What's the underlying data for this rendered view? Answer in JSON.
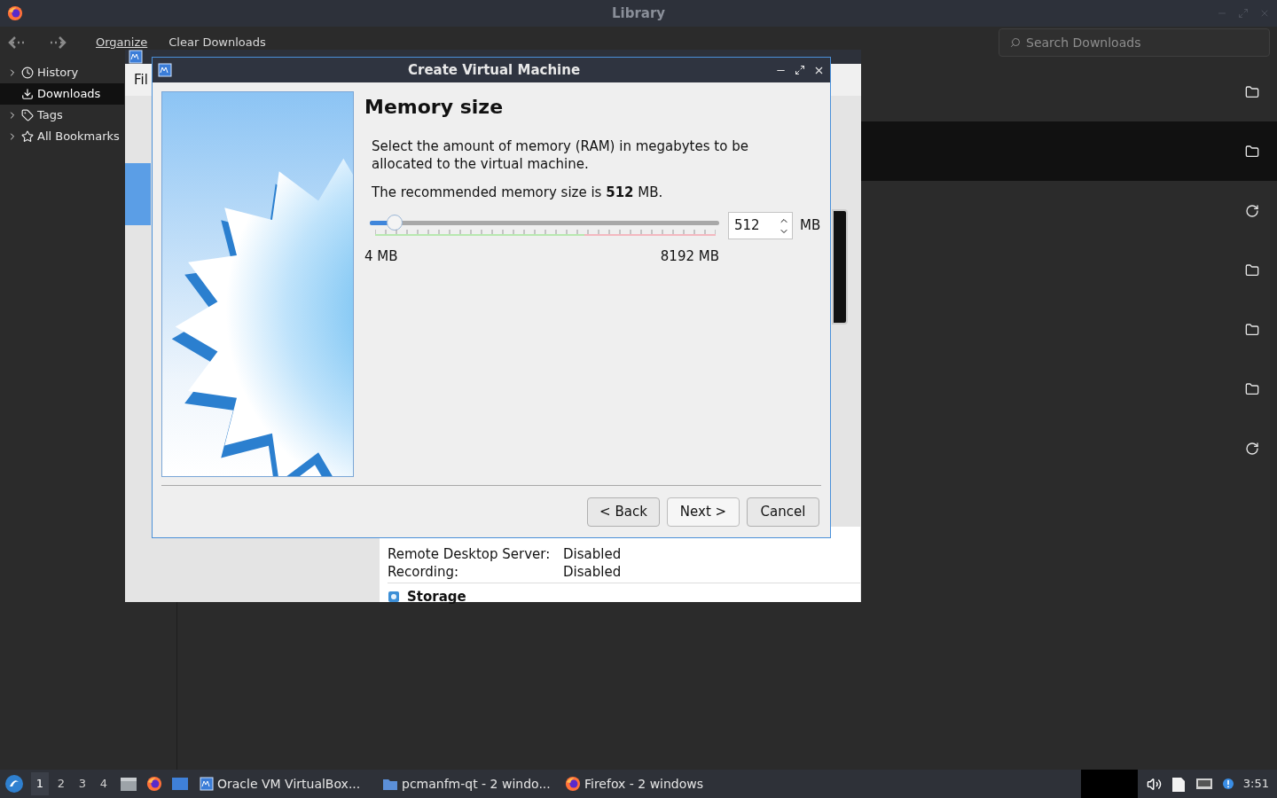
{
  "library": {
    "title": "Library",
    "toolbar": [
      "Organize",
      "Clear Downloads"
    ],
    "search": {
      "placeholder": "Search Downloads"
    },
    "sidebar": [
      {
        "label": "History",
        "expandable": true,
        "selected": false
      },
      {
        "label": "Downloads",
        "expandable": false,
        "selected": true
      },
      {
        "label": "Tags",
        "expandable": true,
        "selected": false
      },
      {
        "label": "All Bookmarks",
        "expandable": true,
        "selected": false
      }
    ],
    "downloads": [
      {
        "kind": "folder",
        "selected": false
      },
      {
        "kind": "folder",
        "selected": true
      },
      {
        "kind": "retry",
        "selected": false
      },
      {
        "kind": "folder",
        "selected": false
      },
      {
        "kind": "folder",
        "selected": false
      },
      {
        "kind": "folder",
        "selected": false
      },
      {
        "kind": "retry",
        "selected": false
      }
    ]
  },
  "vbox_manager": {
    "menu": "Fil",
    "details": [
      {
        "label": "Remote Desktop Server:",
        "value": "Disabled"
      },
      {
        "label": "Recording:",
        "value": "Disabled"
      }
    ],
    "section": "Storage"
  },
  "dialog": {
    "title": "Create Virtual Machine",
    "heading": "Memory size",
    "description": "Select the amount of memory (RAM) in megabytes to be allocated to the virtual machine.",
    "recommendation": "The recommended memory size is **512** MB.",
    "slider": {
      "level": 0.07,
      "min_label": "4 MB",
      "max_label": "8192 MB"
    },
    "value": "512",
    "unit": "MB",
    "buttons": [
      {
        "label": "< Back",
        "kind": "back"
      },
      {
        "label": "Next >",
        "kind": "next"
      },
      {
        "label": "Cancel",
        "kind": "cancel"
      }
    ]
  },
  "taskbar": {
    "workspaces": [
      {
        "label": "1",
        "selected": true
      },
      {
        "label": "2",
        "selected": false
      },
      {
        "label": "3",
        "selected": false
      },
      {
        "label": "4",
        "selected": false
      }
    ],
    "tasks": [
      {
        "label": "Oracle VM VirtualBox...",
        "kind": "vbox"
      },
      {
        "label": "pcmanfm-qt - 2 windo...",
        "kind": "folder"
      },
      {
        "label": "Firefox - 2 windows",
        "kind": "firefox"
      }
    ],
    "clock": "3:51"
  }
}
